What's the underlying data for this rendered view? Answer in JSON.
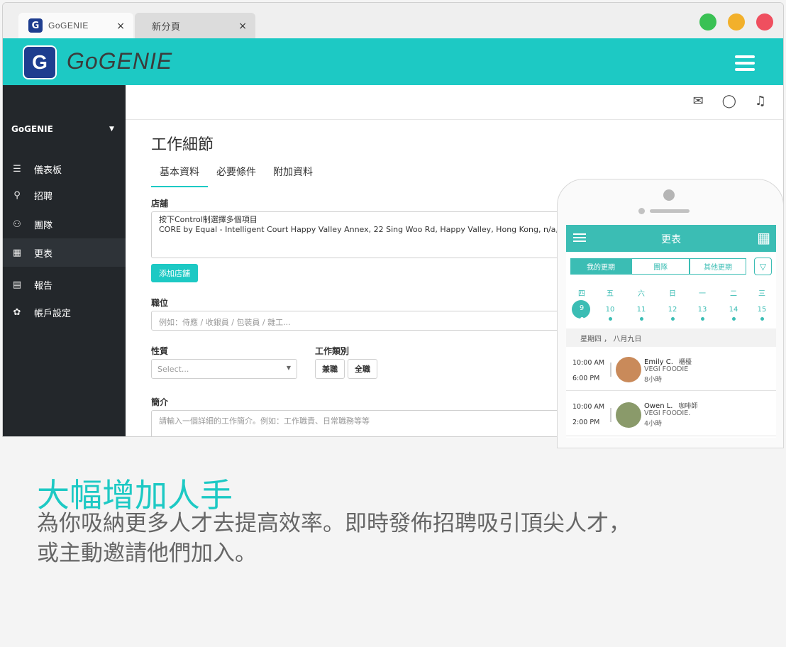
{
  "browser": {
    "tabs": [
      {
        "label": "GoGENIE",
        "close": "×"
      },
      {
        "label": "新分頁",
        "close": "×"
      }
    ],
    "window_dots": [
      "#3ac154",
      "#f2b02b",
      "#ef4f5f"
    ]
  },
  "appbar": {
    "logo_letter": "G",
    "logo_text": "GoGENIE",
    "color": "#1dc9c4"
  },
  "sidebar": {
    "org": "GoGENIE",
    "items": [
      {
        "label": "儀表板",
        "icon": "dashboard-icon",
        "glyph": "☰"
      },
      {
        "label": "招聘",
        "icon": "recruit-icon",
        "glyph": "⚲"
      },
      {
        "label": "團隊",
        "icon": "team-icon",
        "glyph": "⚇"
      },
      {
        "label": "更表",
        "icon": "schedule-icon",
        "glyph": "▦"
      },
      {
        "label": "報告",
        "icon": "report-icon",
        "glyph": "▤"
      },
      {
        "label": "帳戶設定",
        "icon": "gear-icon",
        "glyph": "✿"
      }
    ]
  },
  "topbar": {
    "icons": [
      {
        "name": "mail-icon",
        "glyph": "✉"
      },
      {
        "name": "chat-icon",
        "glyph": "◯"
      },
      {
        "name": "bell-icon",
        "glyph": "♫"
      }
    ]
  },
  "form": {
    "title": "工作細節",
    "tabs": [
      "基本資料",
      "必要條件",
      "附加資料"
    ],
    "store_label": "店舖",
    "store_hint": "按下Control制選擇多個項目",
    "store_value": "CORE by Equal - Intelligent Court Happy Valley Annex, 22 Sing Woo Rd, Happy Valley, Hong Kong, n/a, n/a, Hong",
    "add_store": "添加店舖",
    "position_label": "職位",
    "position_placeholder": "例如：侍應 / 收銀員 / 包裝員 / 雜工...",
    "nature_label": "性質",
    "nature_placeholder": "Select...",
    "type_label": "工作類別",
    "type_options": [
      "兼職",
      "全職"
    ],
    "intro_label": "簡介",
    "intro_placeholder": "請輸入一個詳細的工作簡介。例如：工作職責、日常職務等等"
  },
  "phone": {
    "title": "更表",
    "segments": [
      "我的更期",
      "團隊",
      "其他更期"
    ],
    "weekdays": [
      "四",
      "五",
      "六",
      "日",
      "一",
      "二",
      "三"
    ],
    "days": [
      "9",
      "10",
      "11",
      "12",
      "13",
      "14",
      "15"
    ],
    "date_label": "星期四 ， 八月九日",
    "shifts": [
      {
        "start": "10:00 AM",
        "end": "6:00 PM",
        "name": "Emily C.",
        "role": "櫃檯",
        "company": "VEGI FOODIE",
        "hours": "8小時",
        "avatar_color": "#c98a5a"
      },
      {
        "start": "10:00 AM",
        "end": "2:00 PM",
        "name": "Owen L.",
        "role": "咖啡師",
        "company": "VEGI FOODIE.",
        "hours": "4小時",
        "avatar_color": "#8a9a6a"
      }
    ]
  },
  "marketing": {
    "headline": "大幅增加人手",
    "line1": "為你吸納更多人才去提高效率。即時發佈招聘吸引頂尖人才，",
    "line2": "或主動邀請他們加入。"
  }
}
